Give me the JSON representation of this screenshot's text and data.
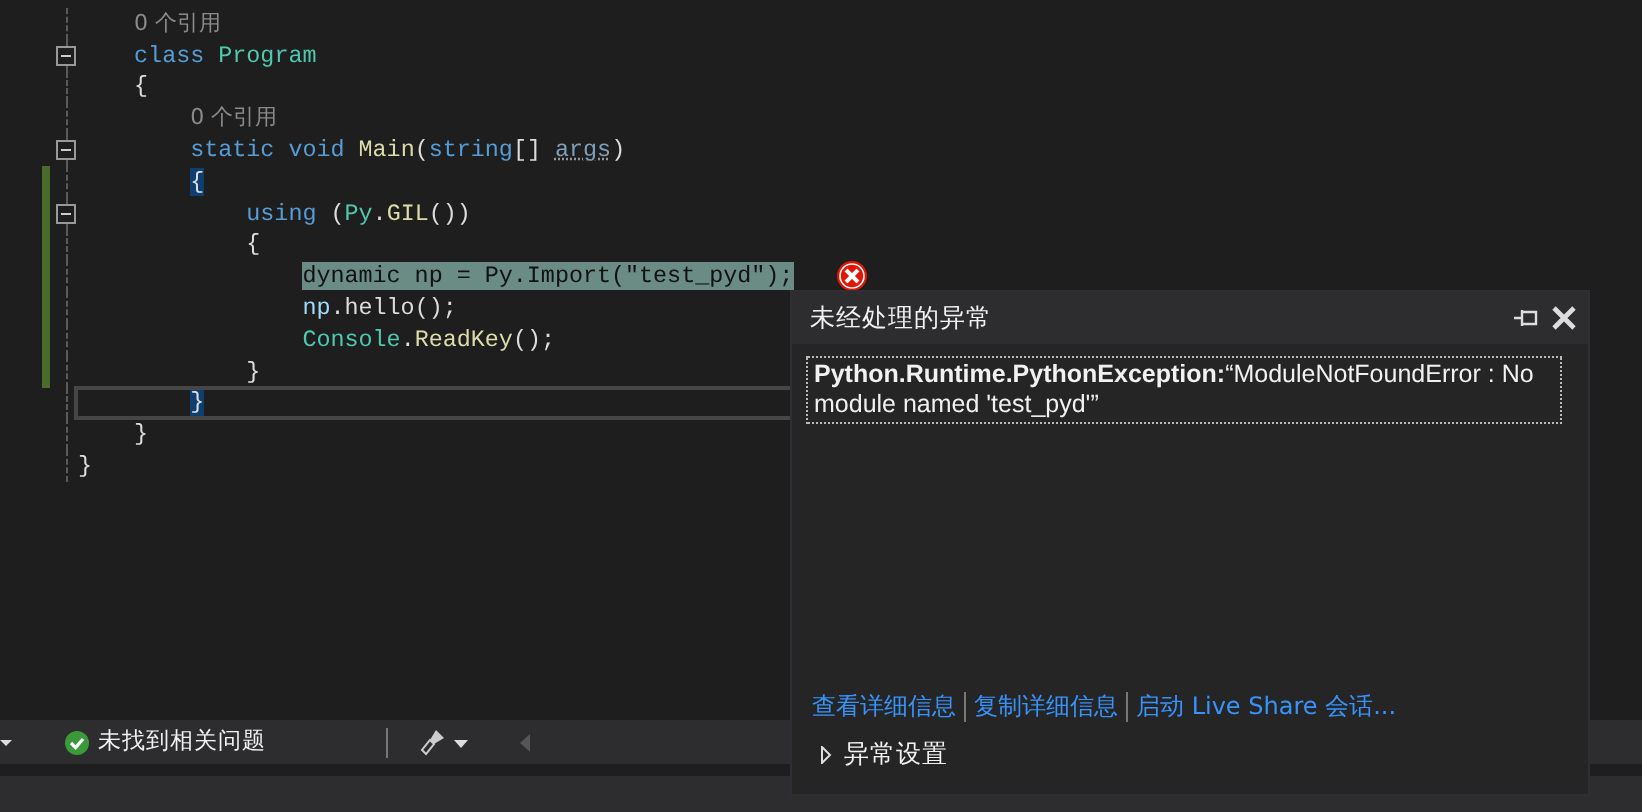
{
  "editor": {
    "lines": [
      {
        "children": [
          {
            "tokens": [
              {
                "text": "0 个引用",
                "kind": "hint"
              }
            ]
          },
          {
            "foldable": true,
            "tokens": [
              {
                "text": "class ",
                "kind": "keyword"
              },
              {
                "text": "Program",
                "kind": "type"
              }
            ]
          },
          {
            "tokens": [
              {
                "text": "{",
                "kind": "plain"
              }
            ]
          },
          {
            "children": [
              {
                "tokens": [
                  {
                    "text": "0 个引用",
                    "kind": "hint"
                  }
                ]
              },
              {
                "foldable": true,
                "tokens": [
                  {
                    "text": "static ",
                    "kind": "keyword"
                  },
                  {
                    "text": "void ",
                    "kind": "keyword"
                  },
                  {
                    "text": "Main",
                    "kind": "method"
                  },
                  {
                    "text": "(",
                    "kind": "plain"
                  },
                  {
                    "text": "string",
                    "kind": "keyword"
                  },
                  {
                    "text": "[] ",
                    "kind": "plain"
                  },
                  {
                    "text": "args",
                    "kind": "unused"
                  },
                  {
                    "text": ")",
                    "kind": "plain"
                  }
                ]
              },
              {
                "changed": true,
                "tokens": [
                  {
                    "text": "{",
                    "kind": "brace_match"
                  }
                ]
              },
              {
                "children": [
                  {
                    "foldable": true,
                    "changed": true,
                    "tokens": [
                      {
                        "text": "using ",
                        "kind": "keyword"
                      },
                      {
                        "text": "(",
                        "kind": "plain"
                      },
                      {
                        "text": "Py",
                        "kind": "type"
                      },
                      {
                        "text": ".",
                        "kind": "plain"
                      },
                      {
                        "text": "GIL",
                        "kind": "method"
                      },
                      {
                        "text": "())",
                        "kind": "plain"
                      }
                    ]
                  },
                  {
                    "changed": true,
                    "tokens": [
                      {
                        "text": "{",
                        "kind": "plain"
                      }
                    ]
                  },
                  {
                    "children": [
                      {
                        "changed": true,
                        "statement": true,
                        "error": true,
                        "tokens": [
                          {
                            "text": "dynamic np = Py.Import(\"test_pyd\");",
                            "kind": "plain"
                          }
                        ]
                      },
                      {
                        "changed": true,
                        "tokens": [
                          {
                            "text": "np",
                            "kind": "variable"
                          },
                          {
                            "text": ".hello();",
                            "kind": "plain"
                          }
                        ]
                      },
                      {
                        "changed": true,
                        "tokens": [
                          {
                            "text": "Console",
                            "kind": "type"
                          },
                          {
                            "text": ".",
                            "kind": "plain"
                          },
                          {
                            "text": "ReadKey",
                            "kind": "method"
                          },
                          {
                            "text": "();",
                            "kind": "plain"
                          }
                        ]
                      }
                    ]
                  },
                  {
                    "changed": true,
                    "tokens": [
                      {
                        "text": "}",
                        "kind": "plain"
                      }
                    ]
                  }
                ]
              },
              {
                "current": true,
                "tokens": [
                  {
                    "text": "}",
                    "kind": "brace_match"
                  }
                ]
              }
            ]
          },
          {
            "tokens": [
              {
                "text": "}",
                "kind": "plain"
              }
            ]
          }
        ]
      },
      {
        "tokens": [
          {
            "text": "}",
            "kind": "plain"
          }
        ]
      }
    ]
  },
  "exception_popup": {
    "title": "未经处理的异常",
    "message": "**Python.Runtime.PythonException:**“ModuleNotFoundError : No module named 'test_pyd'”",
    "links": [
      "查看详细信息",
      "复制详细信息",
      "启动 Live Share 会话..."
    ],
    "settings": {
      "label": "异常设置",
      "expanded": false
    }
  },
  "status_bar": {
    "issues": "未找到相关问题"
  }
}
